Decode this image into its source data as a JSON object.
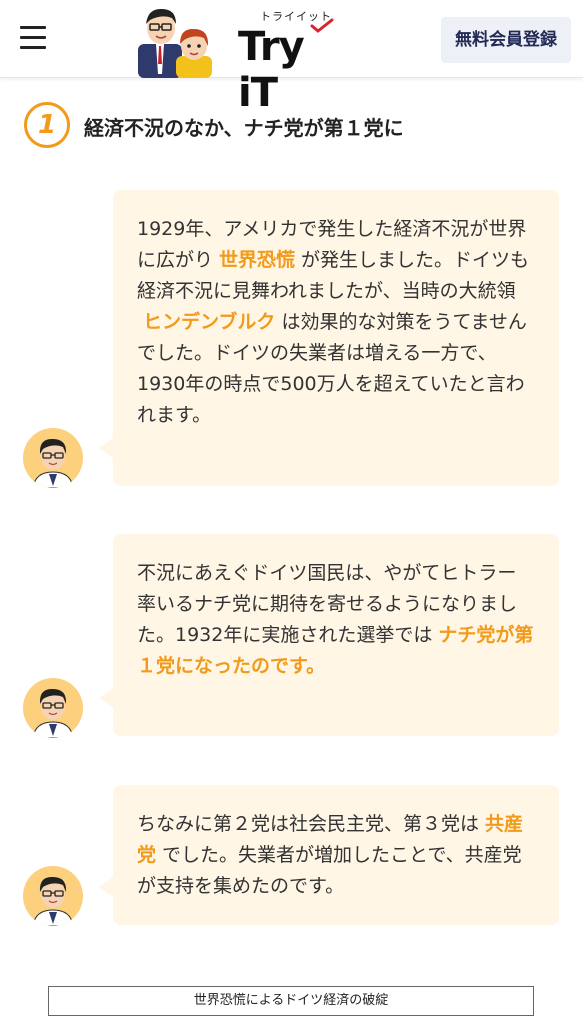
{
  "header": {
    "logo_kana": "トライイット",
    "logo_word": "Try iT",
    "signup_label": "無料会員登録"
  },
  "section": {
    "number": "1",
    "title": "経済不況のなか、ナチ党が第１党に"
  },
  "bubbles": [
    {
      "t1": "1929年、アメリカで発生した経済不況が世界に広がり",
      "h1": "世界恐慌",
      "t2": "が発生しました。ドイツも経済不況に見舞われましたが、当時の大統領",
      "h2": "ヒンデンブルク",
      "t3": "は効果的な対策をうてませんでした。ドイツの失業者は増える一方で、1930年の時点で500万人を超えていたと言われます。"
    },
    {
      "t1": "不況にあえぐドイツ国民は、やがてヒトラー率いるナチ党に期待を寄せるようになりました。1932年に実施された選挙では",
      "h1": "ナチ党が第１党になったのです。"
    },
    {
      "t1": "ちなみに第２党は社会民主党、第３党は",
      "h1": "共産党",
      "t2": "でした。失業者が増加したことで、共産党が支持を集めたのです。"
    }
  ],
  "caption": "世界恐慌によるドイツ経済の破綻",
  "colors": {
    "accent": "#f29a1a",
    "bubble_bg": "#fff6e6",
    "avatar_bg": "#fcd07d",
    "signup_bg": "#eef0f7"
  },
  "icons": {
    "menu": "hamburger-menu-icon",
    "avatar": "teacher-avatar-icon"
  }
}
